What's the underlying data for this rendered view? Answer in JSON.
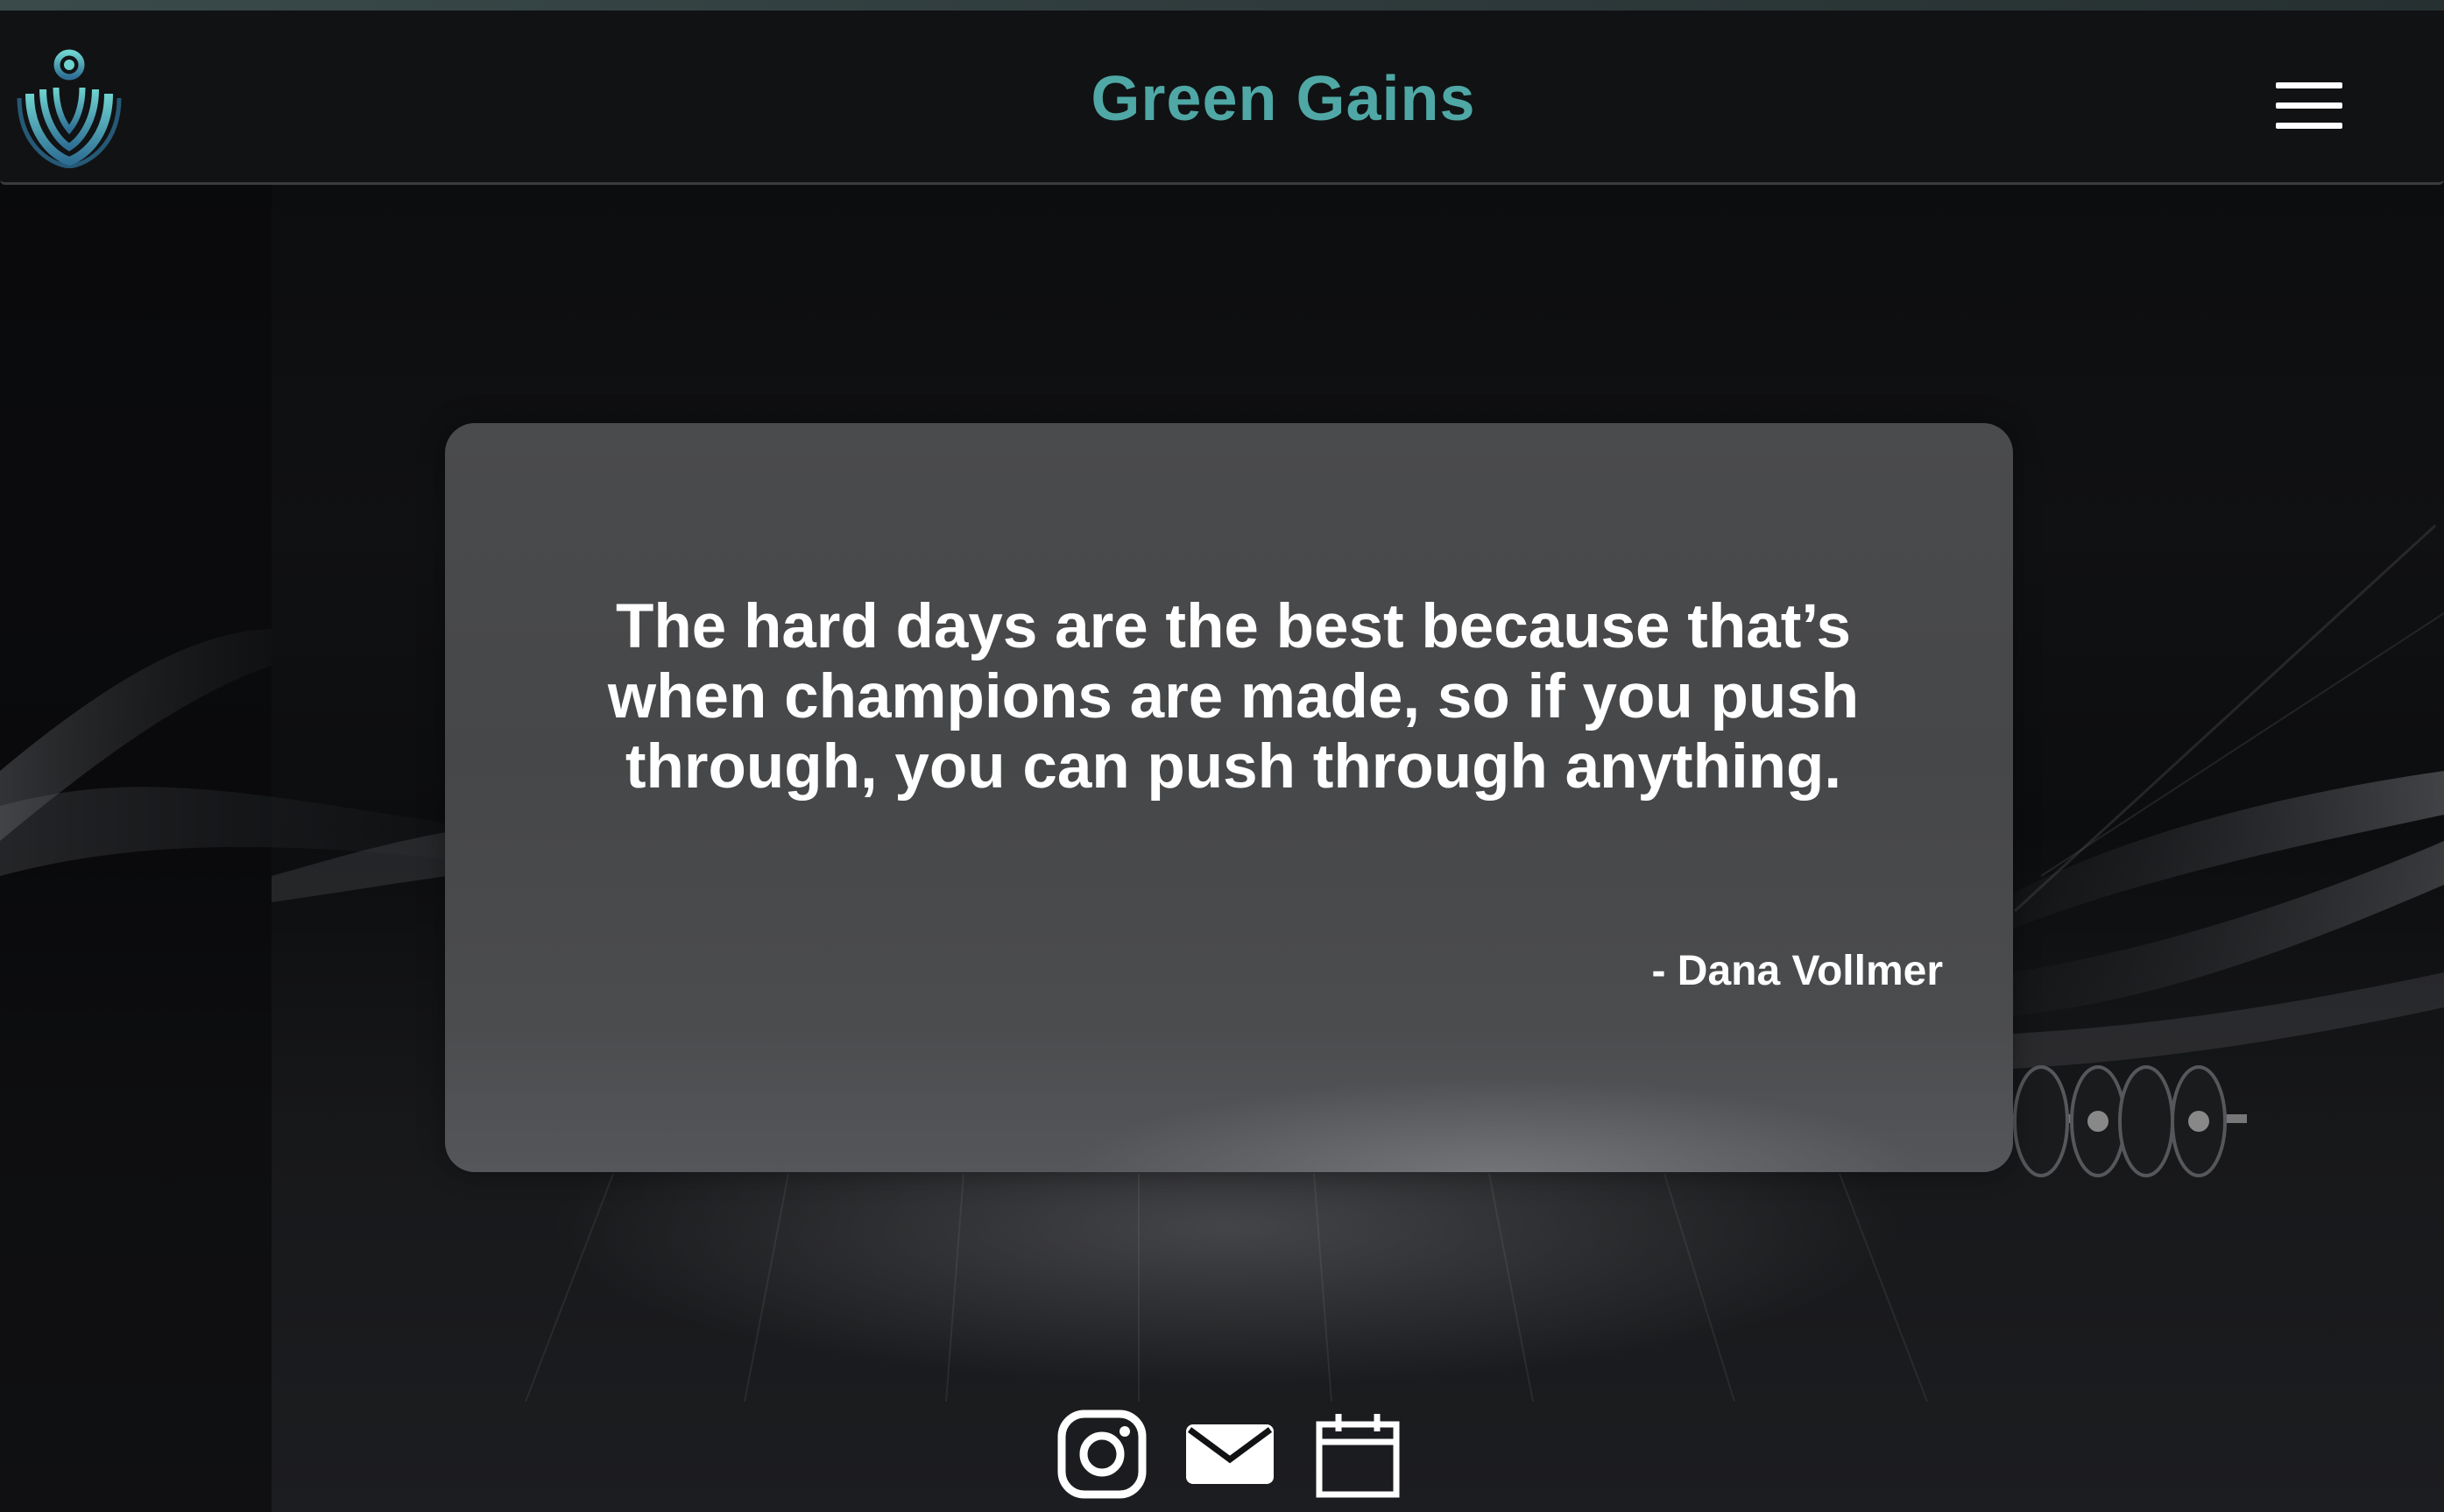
{
  "header": {
    "brand": "Green Gains",
    "logo_icon": "leaf-emblem-logo",
    "menu_icon": "hamburger-menu-icon"
  },
  "quote": {
    "text": "The hard days are the best because that’s when champions are made, so if you push through, you can push through anything.",
    "author": "- Dana Vollmer"
  },
  "footer": {
    "icons": [
      "instagram-icon",
      "mail-icon",
      "calendar-icon"
    ]
  },
  "colors": {
    "brand": "#4fa8a5",
    "background": "#0b0c0e",
    "card": "#4a4b4d",
    "text": "#ffffff"
  }
}
